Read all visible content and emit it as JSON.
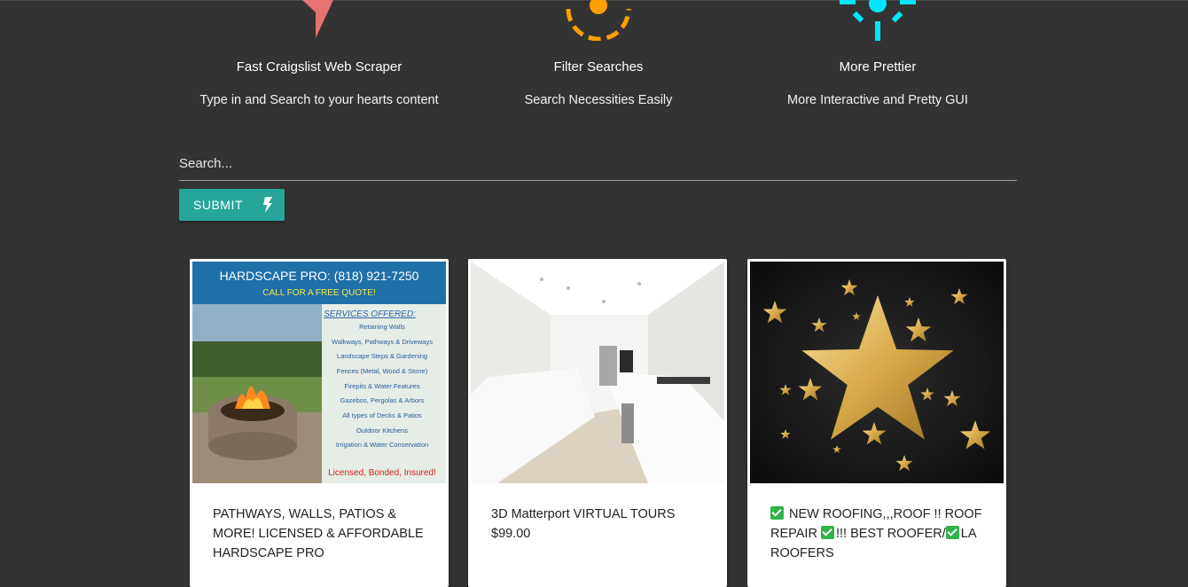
{
  "features": [
    {
      "title": "Fast Craigslist Web Scraper",
      "desc": "Type in and Search to your hearts content",
      "icon": "bolt-icon",
      "color": "#e57373"
    },
    {
      "title": "Filter Searches",
      "desc": "Search Necessities Easily",
      "icon": "filter-icon",
      "color": "#ffa000"
    },
    {
      "title": "More Prettier",
      "desc": "More Interactive and Pretty GUI",
      "icon": "sun-icon",
      "color": "#00e5ff"
    }
  ],
  "search": {
    "placeholder": "Search...",
    "submit_label": "SUBMIT"
  },
  "accent": "#26a69a",
  "cards": [
    {
      "title": "PATHWAYS, WALLS, PATIOS & MORE! LICENSED & AFFORDABLE HARDSCAPE PRO",
      "ad": {
        "header": "HARDSCAPE PRO: (818) 921-7250",
        "subheader": "CALL FOR A FREE QUOTE!",
        "services_title": "SERVICES OFFERED:",
        "services": [
          "Retaining Walls",
          "Walkways, Pathways & Driveways",
          "Landscape Steps & Gardening",
          "Fences (Metal, Wood & Stone)",
          "Firepits & Water Features",
          "Gazebos, Pergolas & Arbors",
          "All types of Decks & Patios",
          "Outdoor Kitchens",
          "Irrigation & Water Conservation"
        ],
        "footer": "Licensed, Bonded, Insured!"
      }
    },
    {
      "title": "3D Matterport VIRTUAL TOURS",
      "price": "$99.00"
    },
    {
      "title_parts": [
        "NEW ROOFING,,,ROOF !! ROOF REPAIR",
        "!!! BEST ROOFER/",
        "LA ROOFERS"
      ]
    }
  ]
}
